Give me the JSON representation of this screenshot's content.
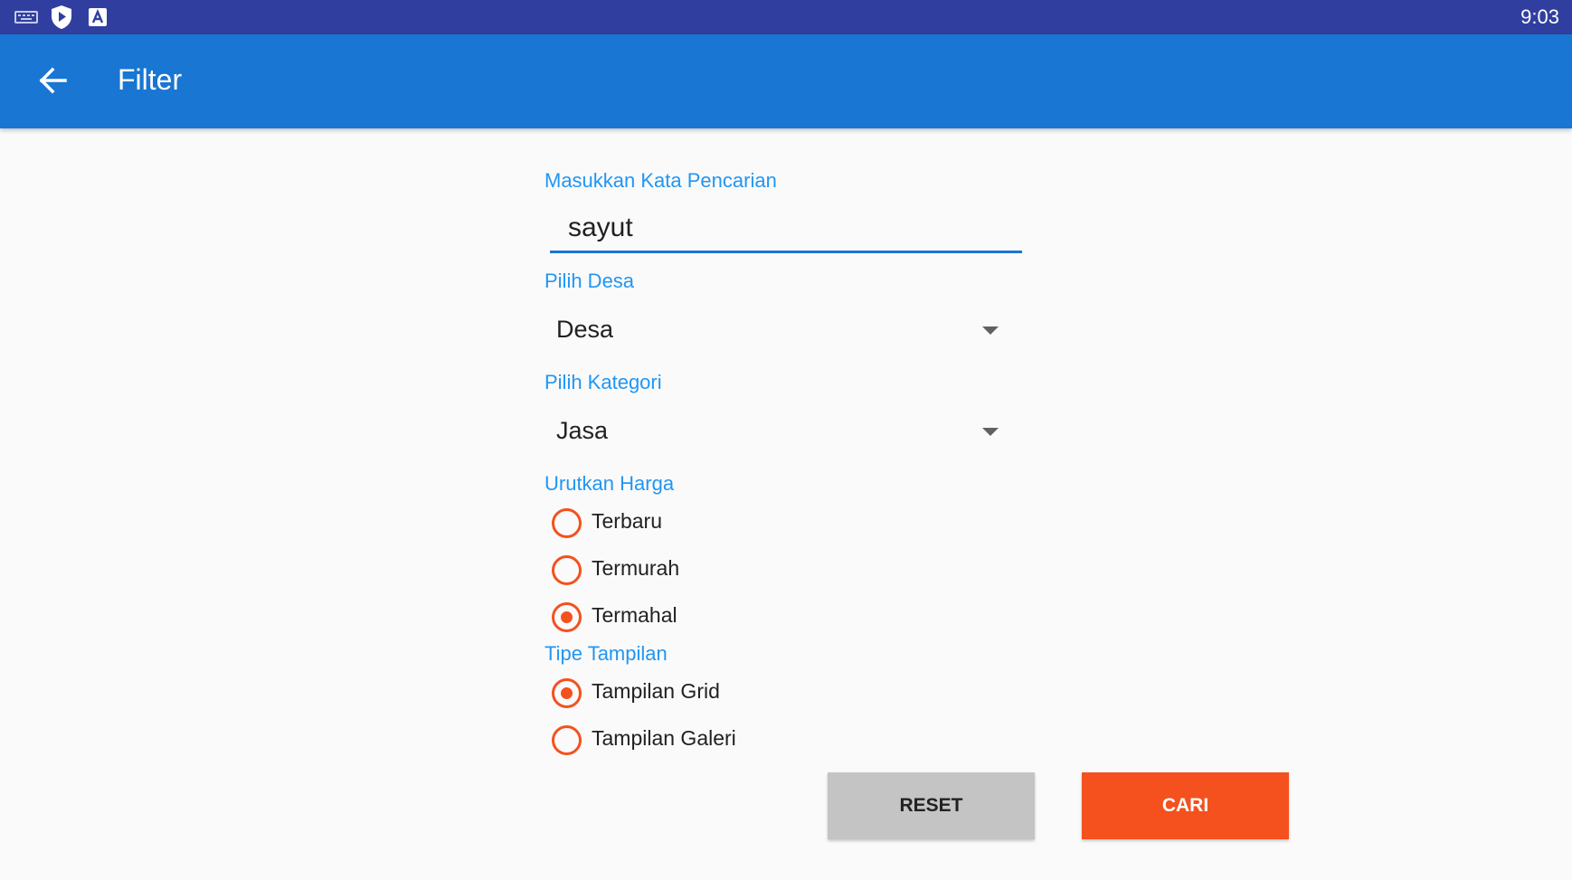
{
  "status_bar": {
    "time": "9:03",
    "icons": [
      "keyboard-icon",
      "shield-play-icon",
      "a-box-icon"
    ]
  },
  "app_bar": {
    "title": "Filter",
    "back_icon": "arrow-left-icon"
  },
  "search": {
    "label": "Masukkan Kata Pencarian",
    "value": "sayut"
  },
  "desa": {
    "label": "Pilih Desa",
    "selected": "Desa"
  },
  "kategori": {
    "label": "Pilih Kategori",
    "selected": "Jasa"
  },
  "urutkan": {
    "label": "Urutkan Harga",
    "options": [
      {
        "label": "Terbaru",
        "checked": false
      },
      {
        "label": "Termurah",
        "checked": false
      },
      {
        "label": "Termahal",
        "checked": true
      }
    ]
  },
  "tampilan": {
    "label": "Tipe Tampilan",
    "options": [
      {
        "label": "Tampilan Grid",
        "checked": true
      },
      {
        "label": "Tampilan Galeri",
        "checked": false
      }
    ]
  },
  "buttons": {
    "reset": "RESET",
    "cari": "CARI"
  },
  "colors": {
    "status_bar": "#303f9f",
    "app_bar": "#1976d2",
    "label": "#2196f3",
    "accent": "#f4511e",
    "reset_button": "#c4c4c4"
  }
}
